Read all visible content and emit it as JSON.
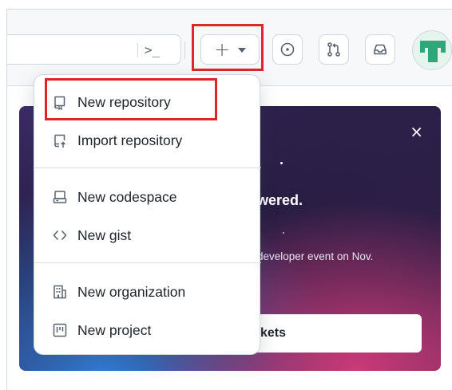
{
  "header": {
    "command_palette_glyph": ">_",
    "create_button": {
      "glyph": "+",
      "icon": "plus-icon",
      "caret_icon": "triangle-down-icon"
    },
    "icon_buttons": [
      {
        "name": "issues",
        "icon": "issue-opened-icon"
      },
      {
        "name": "pull-requests",
        "icon": "git-pull-request-icon"
      },
      {
        "name": "inbox",
        "icon": "inbox-icon"
      }
    ],
    "avatar": {
      "icon": "identicon-avatar",
      "color": "#2ea87a"
    }
  },
  "create_menu": {
    "items": [
      {
        "label": "New repository",
        "icon": "repo-icon"
      },
      {
        "label": "Import repository",
        "icon": "repo-push-icon"
      },
      {
        "label": "New codespace",
        "icon": "codespaces-icon"
      },
      {
        "label": "New gist",
        "icon": "code-icon"
      },
      {
        "label": "New organization",
        "icon": "organization-icon"
      },
      {
        "label": "New project",
        "icon": "project-icon"
      }
    ]
  },
  "banner": {
    "close_glyph": "×",
    "heading_fragment": "wered.",
    "description_fragment": "developer event on Nov.",
    "button_fragment": "kets"
  },
  "colors": {
    "highlight": "#e0242b",
    "border": "#d0d7de",
    "text": "#1f2328",
    "muted_icon": "#59636e"
  }
}
